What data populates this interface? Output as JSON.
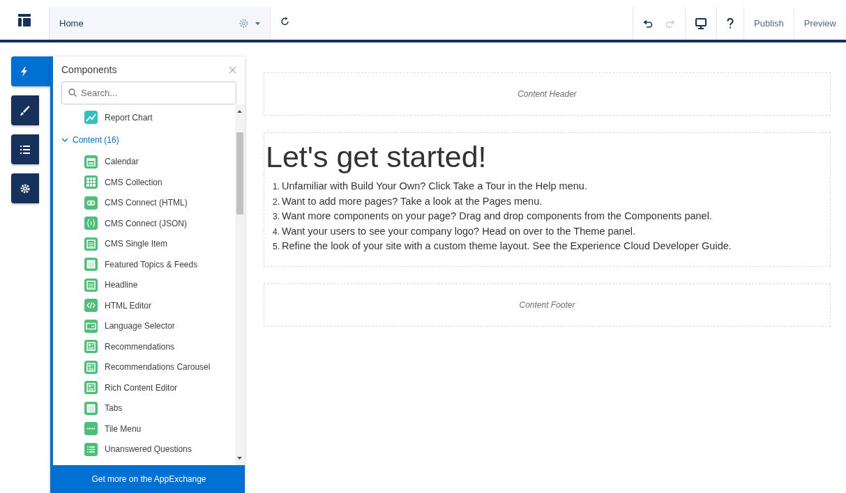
{
  "toolbar": {
    "page_selector": {
      "value": "Home"
    },
    "history": [
      {
        "kind": "undo",
        "disabled": false
      },
      {
        "kind": "redo",
        "disabled": true
      }
    ],
    "buttons": [
      "Publish",
      "Preview"
    ]
  },
  "rail_tabs": [
    {
      "kind": "bolt",
      "selected": true
    },
    {
      "kind": "brush",
      "selected": false
    },
    {
      "kind": "list",
      "selected": false
    },
    {
      "kind": "gear",
      "selected": false
    }
  ],
  "components_panel": {
    "title": "Components",
    "search": {
      "placeholder": "Search..."
    },
    "items": [
      {
        "label": "Report Chart",
        "kind": "chart"
      },
      {
        "label": "Content (16)",
        "expanded": true,
        "children": [
          {
            "label": "Calendar",
            "kind": "calendar"
          },
          {
            "label": "CMS Collection",
            "kind": "grid"
          },
          {
            "label": "CMS Connect (HTML)",
            "kind": "link"
          },
          {
            "label": "CMS Connect (JSON)",
            "kind": "braces"
          },
          {
            "label": "CMS Single Item",
            "kind": "doc"
          },
          {
            "label": "Featured Topics & Feeds",
            "kind": "frame"
          },
          {
            "label": "Headline",
            "kind": "doc"
          },
          {
            "label": "HTML Editor",
            "kind": "code"
          },
          {
            "label": "Language Selector",
            "kind": "select"
          },
          {
            "label": "Recommendations",
            "kind": "article"
          },
          {
            "label": "Recommendations Carousel",
            "kind": "article"
          },
          {
            "label": "Rich Content Editor",
            "kind": "article"
          },
          {
            "label": "Tabs",
            "kind": "frame"
          },
          {
            "label": "Tile Menu",
            "kind": "bar"
          },
          {
            "label": "Unanswered Questions",
            "kind": "lines"
          }
        ]
      }
    ],
    "footer_link": "Get more on the AppExchange"
  },
  "canvas": {
    "header_region": "Content Header",
    "heading": "Let's get started!",
    "steps": [
      {
        "number": "1.",
        "text": "Unfamiliar with Build Your Own? Click Take a Tour in the Help menu."
      },
      {
        "number": "2.",
        "text": "Want to add more pages? Take a look at the Pages menu."
      },
      {
        "number": "3.",
        "text": "Want more components on your page? Drag and drop components from the Components panel."
      },
      {
        "number": "4.",
        "text": "Want your users to see your company logo? Head on over to the Theme panel."
      },
      {
        "number": "5.",
        "text": "Refine the look of your site with a custom theme layout. See the Experience Cloud Developer Guide."
      }
    ],
    "footer_region": "Content Footer"
  }
}
